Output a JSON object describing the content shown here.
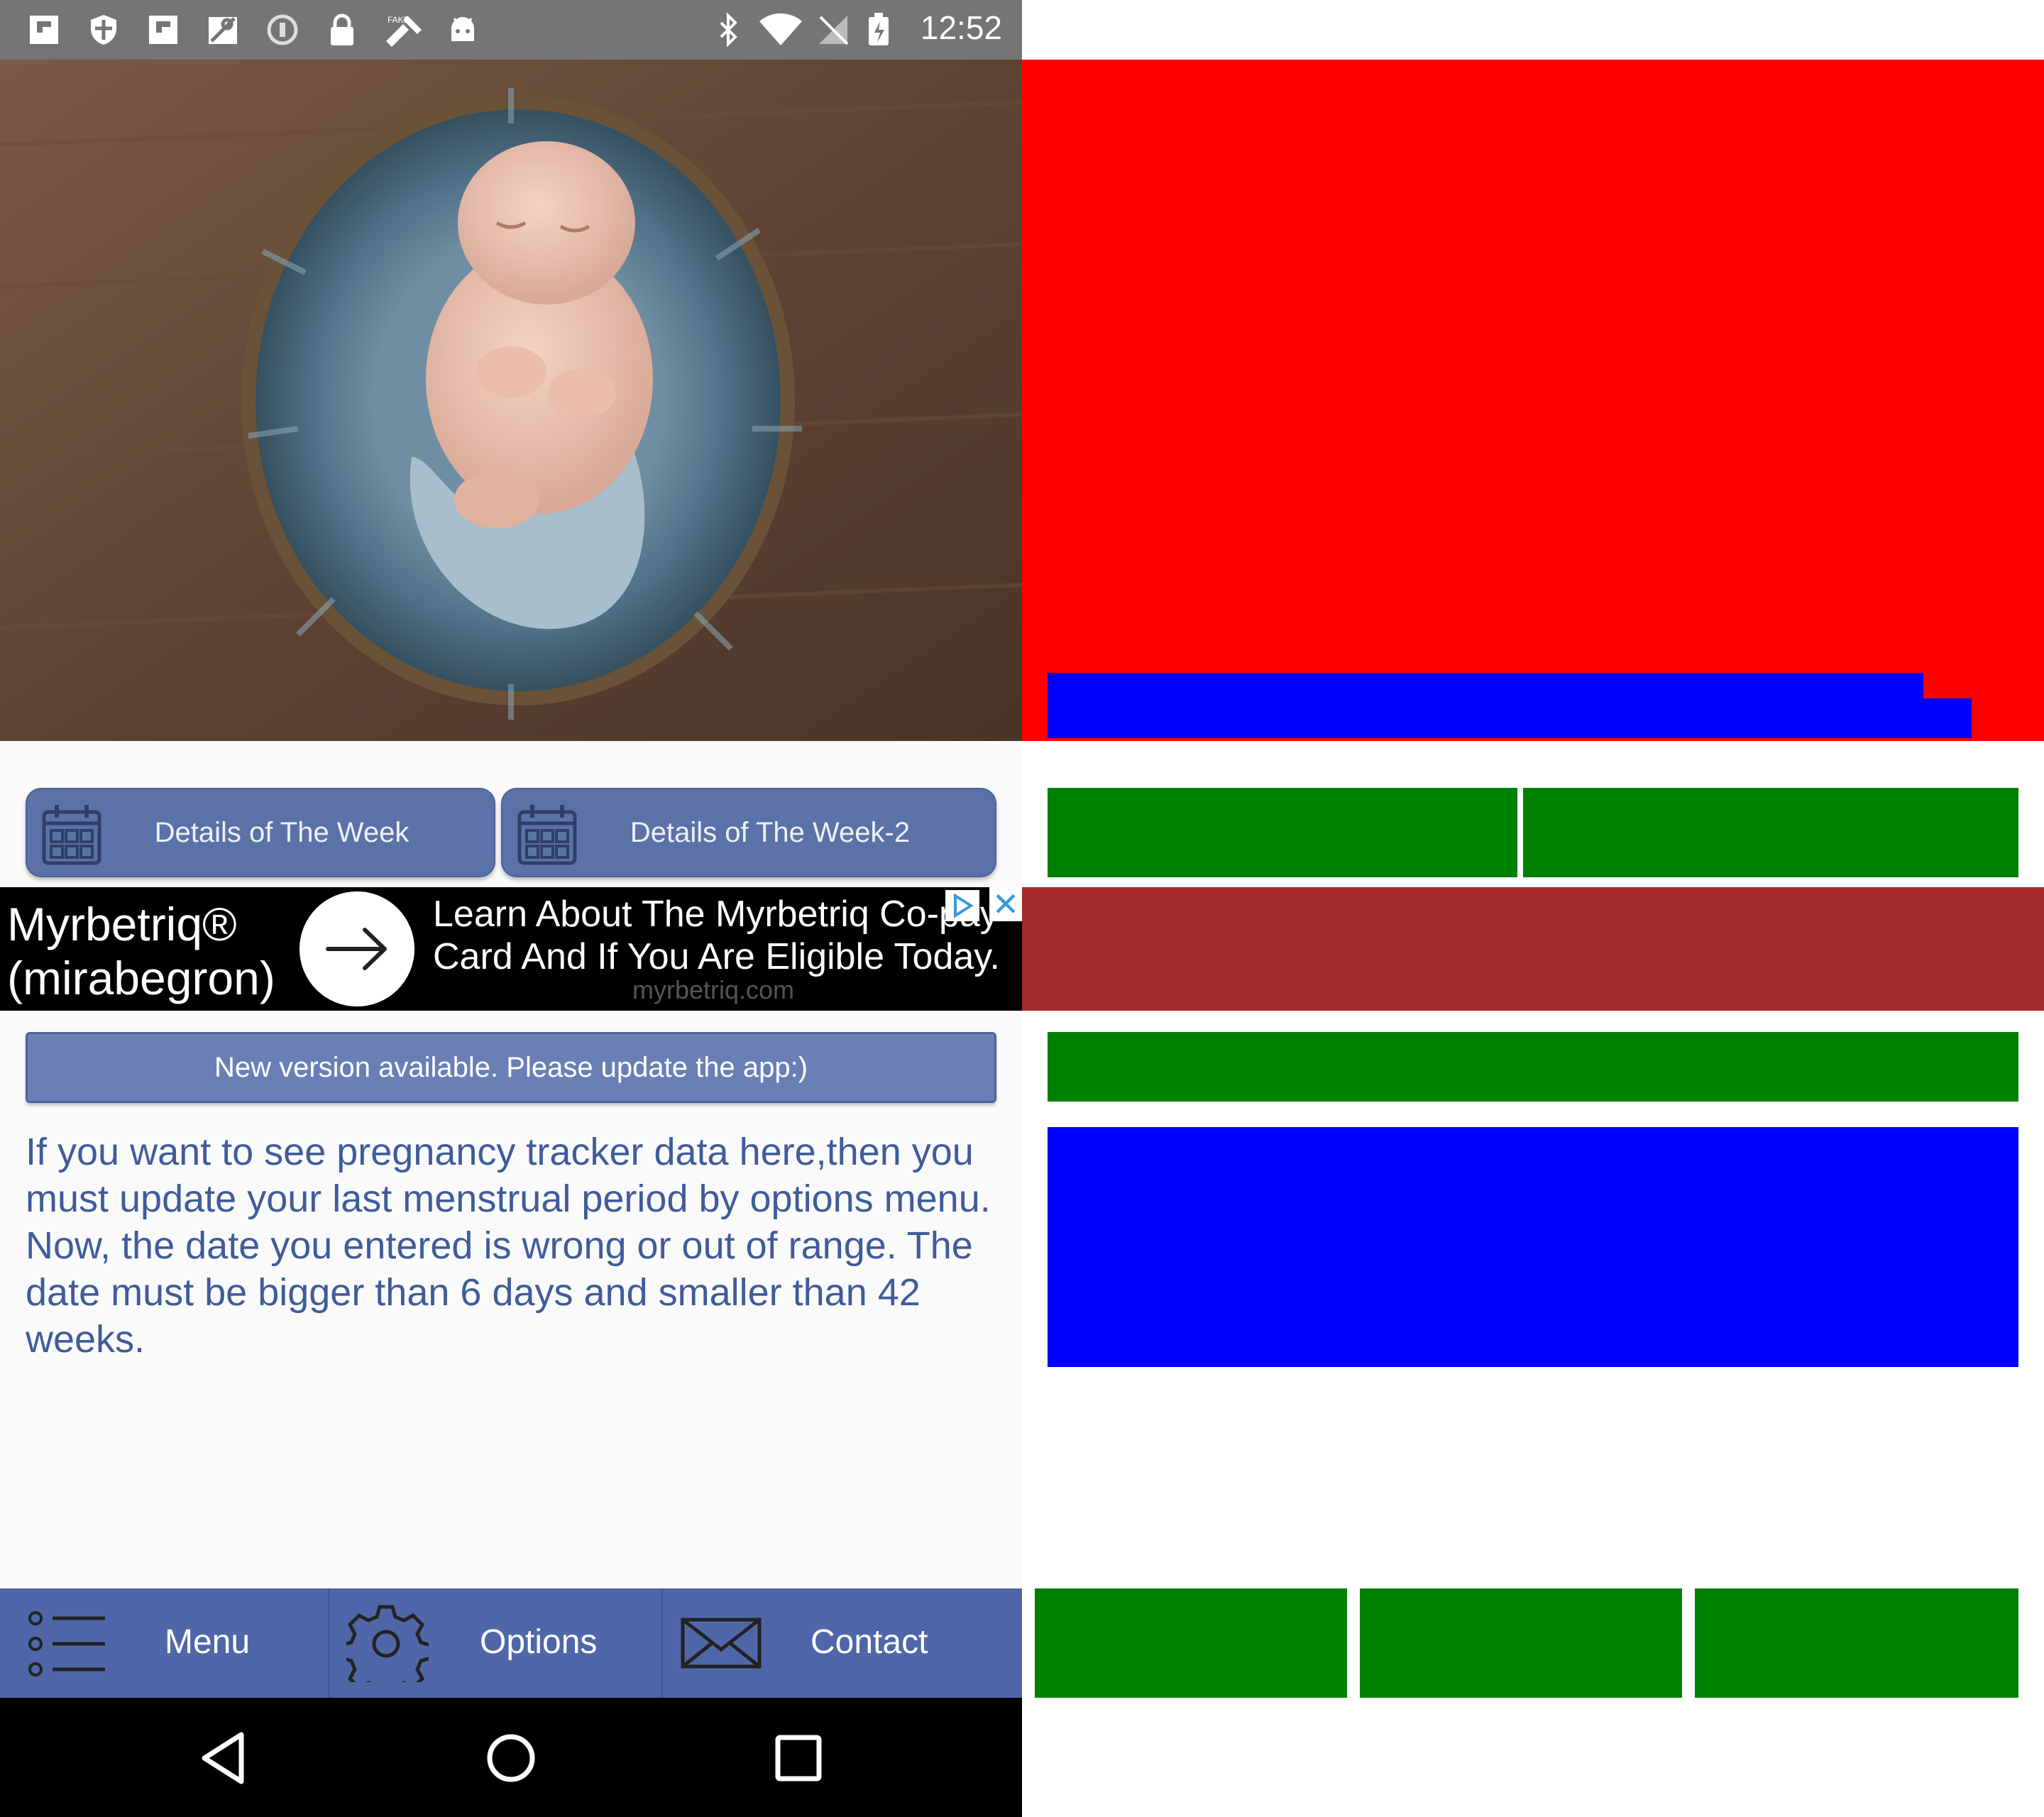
{
  "status_bar": {
    "time": "12:52",
    "left_icons": [
      "flipboard-icon",
      "shield-icon",
      "flipboard-icon",
      "maps-icon",
      "sync-icon",
      "lock-icon",
      "fake-gps-icon",
      "android-icon"
    ],
    "right_icons": [
      "bluetooth-icon",
      "wifi-icon",
      "no-sim-icon",
      "battery-icon"
    ]
  },
  "hero": {
    "image_description_icon": "baby-photo",
    "caption": "-"
  },
  "week_buttons": [
    {
      "label": "Details of The Week",
      "icon": "calendar-icon"
    },
    {
      "label": "Details of The Week-2",
      "icon": "calendar-icon"
    }
  ],
  "ad": {
    "brand_line1": "Myrbetriq®",
    "brand_line2": "(mirabegron)",
    "text_line1": "Learn About The Myrbetriq Co-pay",
    "text_line2": "Card And If You Are Eligible Today.",
    "url": "myrbetriq.com"
  },
  "update_bar": {
    "text": "New version available. Please update the app:)"
  },
  "info_text": "If you want to see pregnancy tracker data here,then you must update your last menstrual period by options menu. Now, the date you entered is wrong or out of range. The date must be bigger than 6 days and smaller than 42 weeks.",
  "bottom_nav": [
    {
      "label": "Menu",
      "icon": "list-menu-icon"
    },
    {
      "label": "Options",
      "icon": "gear-icon"
    },
    {
      "label": "Contact",
      "icon": "envelope-icon"
    }
  ],
  "system_nav": [
    "back-icon",
    "home-icon",
    "recents-icon"
  ],
  "colors": {
    "primary": "#5b72a8",
    "nav": "#4f67a8",
    "text_blue": "#3f5b9b",
    "annot_red": "#ff0000",
    "annot_blue": "#0000ff",
    "annot_green": "#008000",
    "annot_brown": "#a52a2a"
  }
}
